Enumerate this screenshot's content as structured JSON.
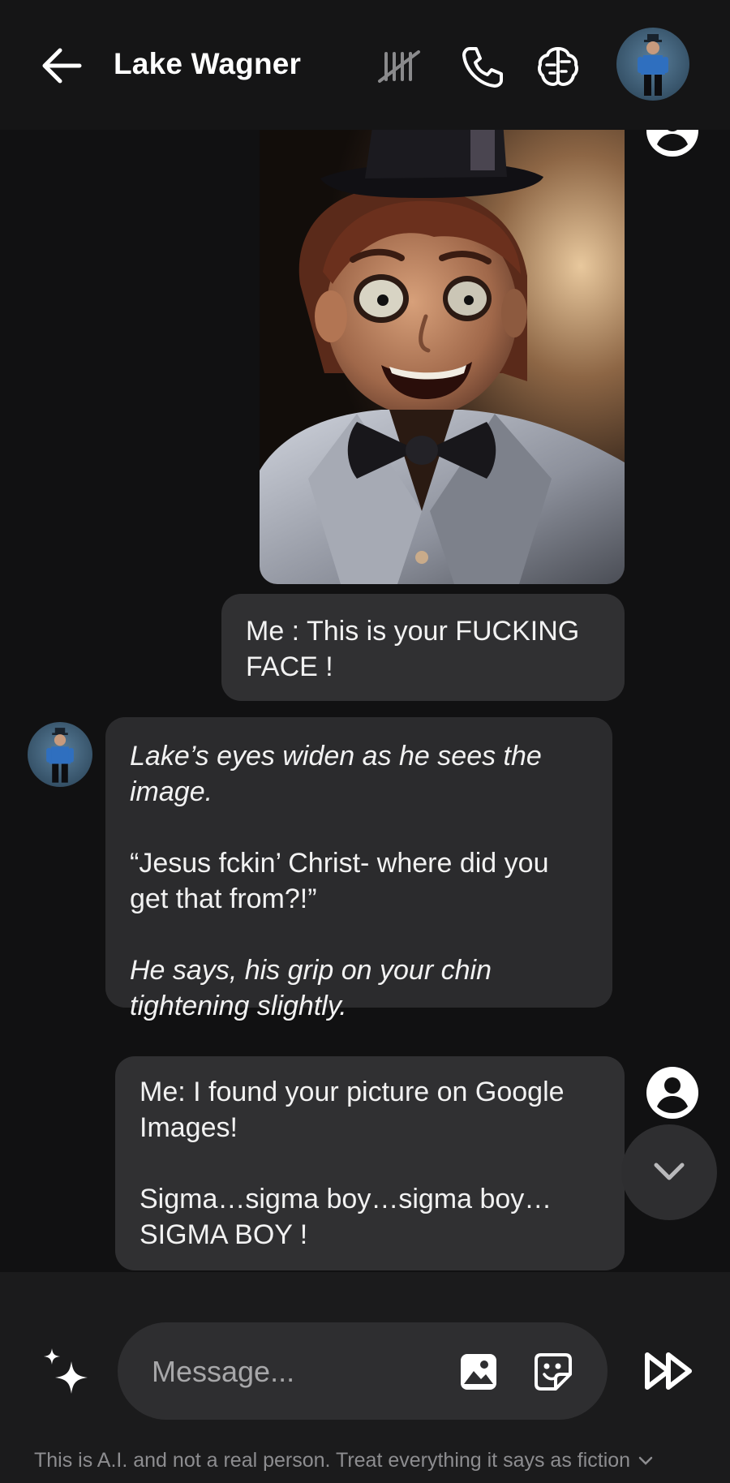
{
  "header": {
    "title": "Lake Wagner"
  },
  "messages": [
    {
      "sender": "user",
      "type": "image"
    },
    {
      "sender": "user",
      "text": "Me : This is your FUCKING FACE !"
    },
    {
      "sender": "character",
      "lines": [
        "Lake’s eyes widen as he sees the image.",
        "“Jesus fckin’ Christ- where did you get that from?!”",
        "He says, his grip on your chin tightening slightly."
      ]
    },
    {
      "sender": "user",
      "lines": [
        "Me: I found your picture on Google Images!",
        "Sigma…sigma boy…sigma boy… SIGMA BOY !"
      ]
    }
  ],
  "composer": {
    "placeholder": "Message..."
  },
  "footer": {
    "disclaimer": "This is A.I. and not a real person. Treat everything it says as fiction"
  },
  "icons": {
    "back": "arrow-left-icon",
    "mute": "muted-tally-icon",
    "call": "phone-icon",
    "brain": "brain-icon",
    "user": "user-circle-icon",
    "scroll": "chevron-down-icon",
    "sparkle": "sparkle-icon",
    "image": "image-icon",
    "sticker": "sticker-icon",
    "send": "fast-forward-icon"
  }
}
